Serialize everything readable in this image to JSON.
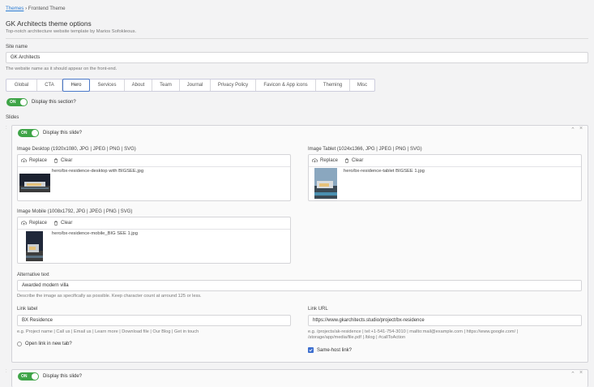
{
  "breadcrumb": {
    "root": "Themes",
    "separator": "›",
    "current": "Frontend Theme"
  },
  "page": {
    "title": "GK Architects theme options",
    "subtitle": "Top-notch architecture website template by Marios Sofokleous."
  },
  "site_name": {
    "label": "Site name",
    "value": "GK Architects",
    "hint": "The website name as it should appear on the front-end."
  },
  "tabs": [
    {
      "label": "Global"
    },
    {
      "label": "CTA"
    },
    {
      "label": "Hero"
    },
    {
      "label": "Services"
    },
    {
      "label": "About"
    },
    {
      "label": "Team"
    },
    {
      "label": "Journal"
    },
    {
      "label": "Privacy Policy"
    },
    {
      "label": "Favicon & App icons"
    },
    {
      "label": "Theming"
    },
    {
      "label": "Misc"
    }
  ],
  "active_tab": "Hero",
  "section_toggle": {
    "state": "ON",
    "label": "Display this section?"
  },
  "slides_label": "Slides",
  "slide": {
    "toggle": {
      "state": "ON",
      "label": "Display this slide?"
    },
    "controls": {
      "collapse": "⌃",
      "close": "×"
    },
    "image_desktop": {
      "label": "Image Desktop (1920x1080, JPG | JPEG | PNG | SVG)",
      "replace": "Replace",
      "clear": "Clear",
      "file": "hero/bx-residence-desktop with BIGSEE.jpg"
    },
    "image_tablet": {
      "label": "Image Tablet (1024x1366, JPG | JPEG | PNG | SVG)",
      "replace": "Replace",
      "clear": "Clear",
      "file": "hero/bx-residence-tablet BIGSEE 1.jpg"
    },
    "image_mobile": {
      "label": "Image Mobile (1008x1792, JPG | JPEG | PNG | SVG)",
      "replace": "Replace",
      "clear": "Clear",
      "file": "hero/bx-residence-mobile_BIG SEE 1.jpg"
    },
    "alt_text": {
      "label": "Alternative text",
      "value": "Awarded modern villa",
      "hint": "Describe the image as specifically as possible. Keep character count at arround 125 or less."
    },
    "link_label": {
      "label": "Link label",
      "value": "BX Residence",
      "hint": "e.g. Project name | Call us | Email us | Learn more | Download file | Our Blog | Get in touch"
    },
    "link_url": {
      "label": "Link URL",
      "value": "https://www.gkarchitects.studio/project/bx-residence",
      "hint_line1": "e.g. /projects/ak-residence | tel:+1-541-754-3010 | mailto:mail@example.com | https://www.google.com/ |",
      "hint_line2": "/storage/app/media/file.pdf | /blog | #callToAction"
    },
    "new_tab": {
      "label": "Open link in new tab?",
      "checked": false
    },
    "same_host": {
      "label": "Same-host link?",
      "checked": true
    }
  },
  "slide2": {
    "toggle": {
      "state": "ON",
      "label": "Display this slide?"
    }
  },
  "colors": {
    "accent": "#3d6fcf",
    "toggle_on": "#3ea447",
    "link": "#2a7bd3"
  }
}
